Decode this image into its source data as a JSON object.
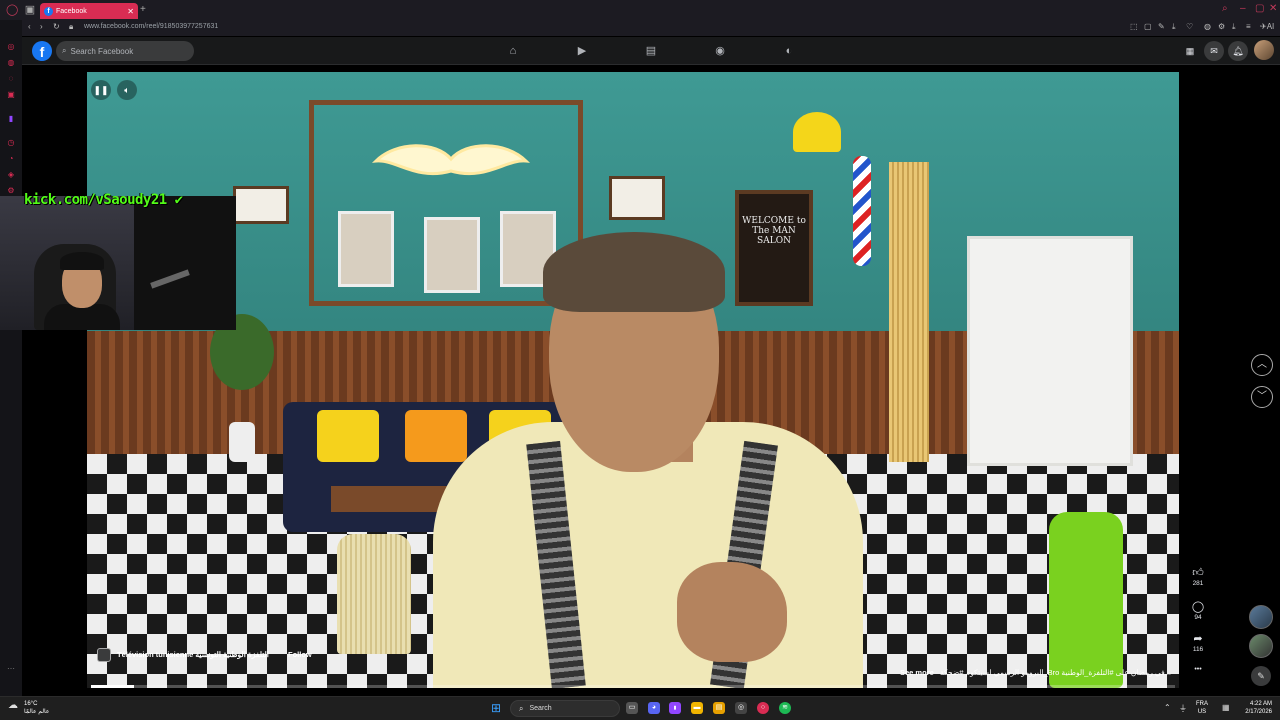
{
  "browser": {
    "tab_title": "Facebook",
    "url": "www.facebook.com/reel/918503977257631",
    "new_tab": "+",
    "ai_label": "AI"
  },
  "facebook": {
    "logo_letter": "f",
    "search_placeholder": "Search Facebook",
    "nav": [
      "home-icon",
      "video-icon",
      "marketplace-icon",
      "groups-icon",
      "gaming-icon"
    ]
  },
  "stream_overlay": {
    "kick_text": "kick.com/vSaoudy21"
  },
  "video": {
    "welcome_sign": "WELCOME to The MAN SALON",
    "page_name": "Télévision tunisienne التلفزة الوطنية التونسية",
    "follow_label": "Follow",
    "see_more": "See more",
    "caption": "البرومو الرسمي لسيتكوم #ضحكة_Bro في رمضان على #التلفزة_الوطنية...",
    "progress": 0.04
  },
  "actions": {
    "likes": "281",
    "comments": "94",
    "shares": "116",
    "more": "•••"
  },
  "taskbar": {
    "temperature": "16°C",
    "weather_text": "عالم عالمًا",
    "search_label": "Search",
    "lang_top": "FRA",
    "lang_bottom": "US",
    "time": "4:22 AM",
    "date": "2/17/2026"
  }
}
